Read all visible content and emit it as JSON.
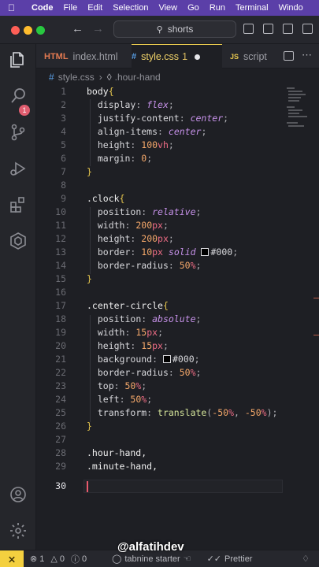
{
  "menubar": {
    "app": "Code",
    "items": [
      "File",
      "Edit",
      "Selection",
      "View",
      "Go",
      "Run",
      "Terminal",
      "Windo"
    ]
  },
  "titlebar": {
    "search_text": "shorts"
  },
  "activitybar": {
    "badge": "1"
  },
  "tabs": [
    {
      "label": "index.html",
      "icon": "HTML"
    },
    {
      "label": "style.css",
      "icon": "#",
      "modified": "1"
    },
    {
      "label": "script",
      "icon": "JS"
    }
  ],
  "breadcrumb": {
    "file": "style.css",
    "symbol": ".hour-hand"
  },
  "editor": {
    "current_line": 30,
    "lines": [
      {
        "n": "1"
      },
      {
        "n": "2"
      },
      {
        "n": "3"
      },
      {
        "n": "4"
      },
      {
        "n": "5"
      },
      {
        "n": "6"
      },
      {
        "n": "7"
      },
      {
        "n": "8"
      },
      {
        "n": "9"
      },
      {
        "n": "10"
      },
      {
        "n": "11"
      },
      {
        "n": "12"
      },
      {
        "n": "13"
      },
      {
        "n": "14"
      },
      {
        "n": "15"
      },
      {
        "n": "16"
      },
      {
        "n": "17"
      },
      {
        "n": "18"
      },
      {
        "n": "19"
      },
      {
        "n": "20"
      },
      {
        "n": "21"
      },
      {
        "n": "22"
      },
      {
        "n": "23"
      },
      {
        "n": "24"
      },
      {
        "n": "25"
      },
      {
        "n": "26"
      },
      {
        "n": "27"
      },
      {
        "n": "28"
      },
      {
        "n": "29"
      },
      {
        "n": "30"
      }
    ],
    "code": {
      "l1": "body",
      "l2p": "display",
      "l2v": "flex",
      "l3p": "justify-content",
      "l3v": "center",
      "l4p": "align-items",
      "l4v": "center",
      "l5p": "height",
      "l5n": "100",
      "l5u": "vh",
      "l6p": "margin",
      "l6n": "0",
      "l9": ".clock",
      "l10p": "position",
      "l10v": "relative",
      "l11p": "width",
      "l11n": "200",
      "l11u": "px",
      "l12p": "height",
      "l12n": "200",
      "l12u": "px",
      "l13p": "border",
      "l13n": "10",
      "l13u": "px",
      "l13k": "solid",
      "l13c": "#000",
      "l14p": "border-radius",
      "l14n": "50",
      "l14u": "%",
      "l17": ".center-circle",
      "l18p": "position",
      "l18v": "absolute",
      "l19p": "width",
      "l19n": "15",
      "l19u": "px",
      "l20p": "height",
      "l20n": "15",
      "l20u": "px",
      "l21p": "background",
      "l21c": "#000",
      "l22p": "border-radius",
      "l22n": "50",
      "l22u": "%",
      "l23p": "top",
      "l23n": "50",
      "l23u": "%",
      "l24p": "left",
      "l24n": "50",
      "l24u": "%",
      "l25p": "transform",
      "l25f": "translate",
      "l25a": "-50",
      "l25b": "-50",
      "l25u": "%",
      "l28": ".hour-hand,",
      "l29": ".minute-hand,"
    }
  },
  "statusbar": {
    "errors": "1",
    "warnings": "0",
    "info": "0",
    "tabnine": "tabnine starter",
    "prettier": "Prettier"
  },
  "watermark": "@alfatihdev",
  "colors": {
    "accent": "#e8c84e",
    "menubar": "#5b3fa8",
    "error": "#e05d6f"
  }
}
